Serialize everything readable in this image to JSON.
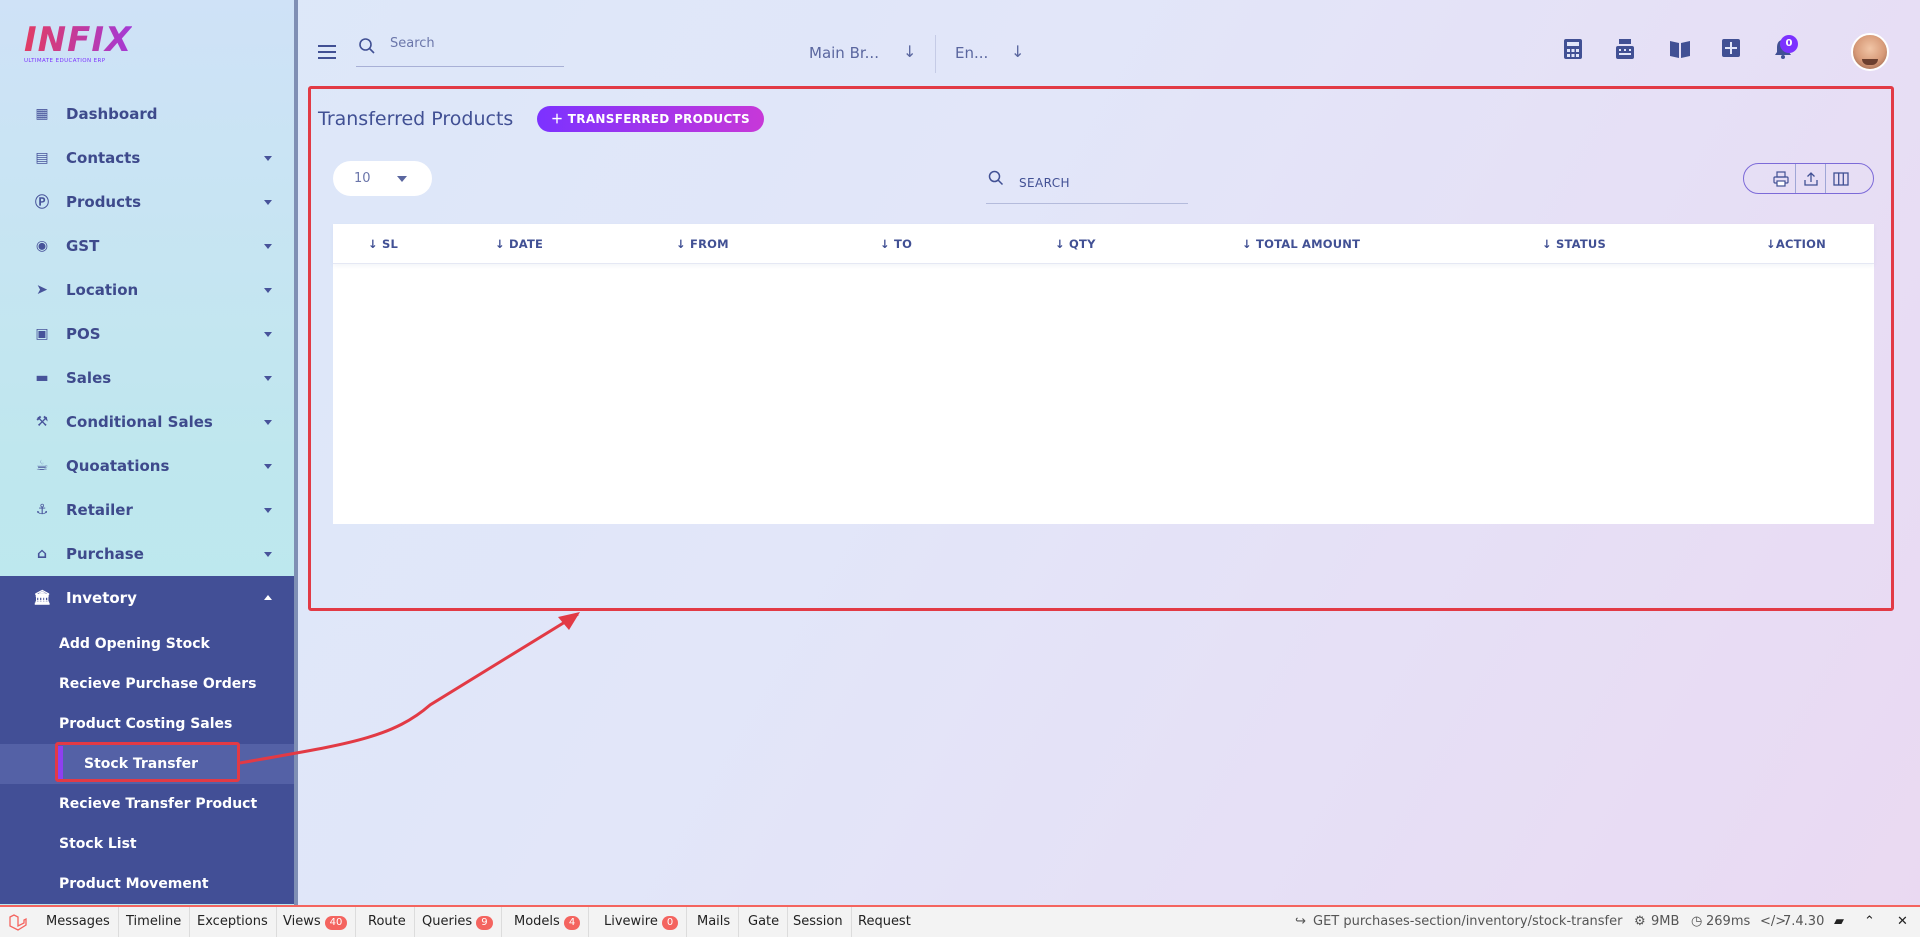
{
  "app": {
    "logo": "INFIX",
    "logo_sub": "ULTIMATE EDUCATION ERP"
  },
  "sidebar": {
    "items": [
      {
        "label": "Dashboard",
        "icon": "grid-icon"
      },
      {
        "label": "Contacts",
        "icon": "document-icon"
      },
      {
        "label": "Products",
        "icon": "product-icon"
      },
      {
        "label": "GST",
        "icon": "gst-icon"
      },
      {
        "label": "Location",
        "icon": "location-arrow-icon"
      },
      {
        "label": "POS",
        "icon": "pos-icon"
      },
      {
        "label": "Sales",
        "icon": "store-icon"
      },
      {
        "label": "Conditional Sales",
        "icon": "gavel-icon"
      },
      {
        "label": "Quoatations",
        "icon": "coffee-icon"
      },
      {
        "label": "Retailer",
        "icon": "retailer-icon"
      },
      {
        "label": "Purchase",
        "icon": "shop-icon"
      }
    ],
    "inventory": {
      "label": "Invetory",
      "icon": "bank-icon",
      "subitems": [
        "Add Opening Stock",
        "Recieve Purchase Orders",
        "Product Costing Sales",
        "Stock Transfer",
        "Recieve Transfer Product",
        "Stock List",
        "Product Movement"
      ],
      "active": "Stock Transfer"
    }
  },
  "topbar": {
    "search_placeholder": "Search",
    "branch": "Main Br...",
    "language": "En...",
    "notifications_count": "0"
  },
  "main": {
    "title": "Transferred Products",
    "add_button": "TRANSFERRED PRODUCTS",
    "page_size": "10",
    "search_placeholder": "SEARCH",
    "columns": [
      "SL",
      "DATE",
      "FROM",
      "TO",
      "QTY",
      "TOTAL AMOUNT",
      "STATUS",
      "ACTION"
    ]
  },
  "debugbar": {
    "tabs": [
      {
        "label": "Messages"
      },
      {
        "label": "Timeline"
      },
      {
        "label": "Exceptions"
      },
      {
        "label": "Views",
        "count": "40"
      },
      {
        "label": "Route"
      },
      {
        "label": "Queries",
        "count": "9"
      },
      {
        "label": "Models",
        "count": "4"
      },
      {
        "label": "Livewire",
        "count": "0"
      },
      {
        "label": "Mails"
      },
      {
        "label": "Gate"
      },
      {
        "label": "Session"
      },
      {
        "label": "Request"
      }
    ],
    "request": "GET purchases-section/inventory/stock-transfer",
    "memory": "9MB",
    "time": "269ms",
    "php_version": "7.4.30"
  },
  "colors": {
    "accent": "#7c32ff",
    "primary_text": "#415094",
    "annotation": "#e23a45",
    "sidebar_active": "#424f96"
  }
}
